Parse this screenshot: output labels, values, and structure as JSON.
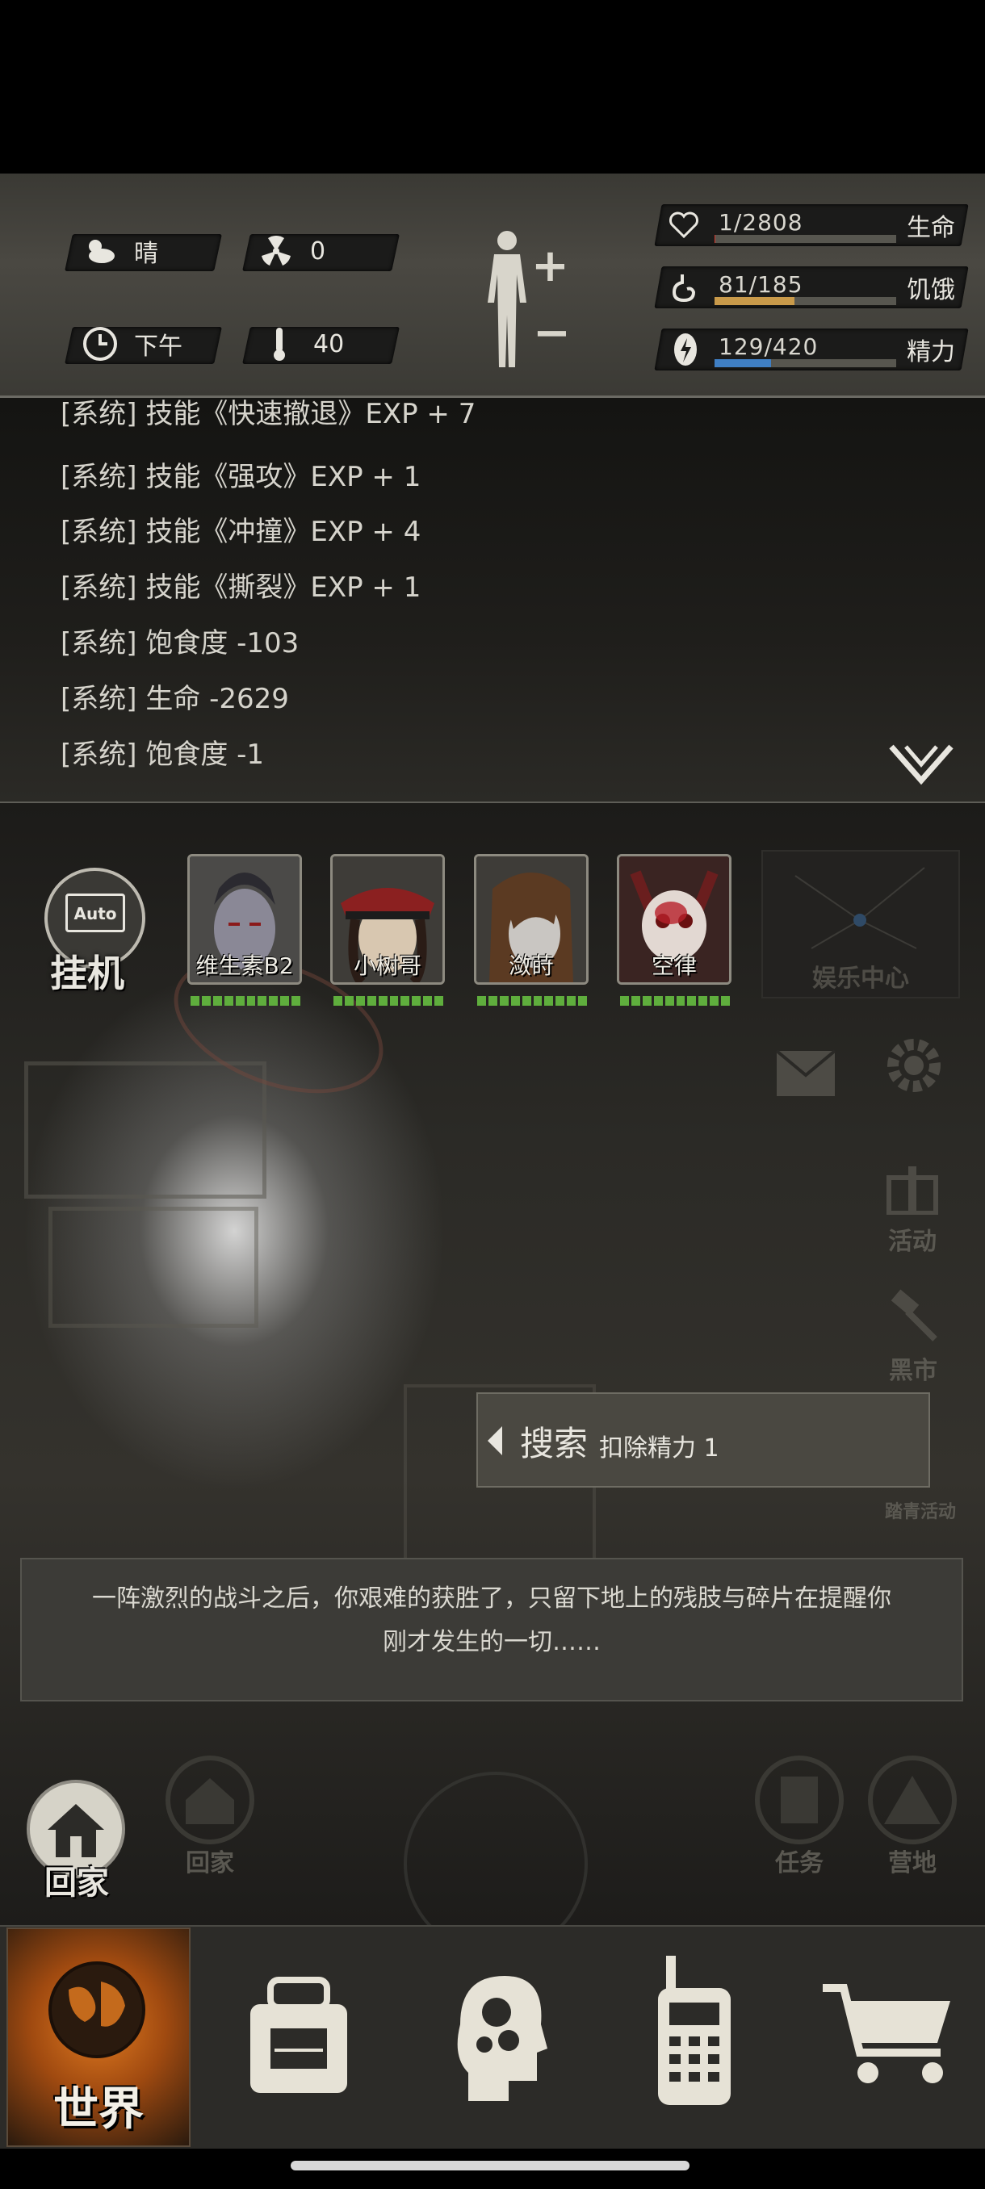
{
  "status": {
    "weather": "晴",
    "radiation": "0",
    "time_of_day": "下午",
    "temperature": "40",
    "stats": [
      {
        "value": "1/2808",
        "label": "生命",
        "fraction": 0.0004,
        "color": "#d8382c",
        "icon": "heart-icon"
      },
      {
        "value": "81/185",
        "label": "饥饿",
        "fraction": 0.44,
        "color": "#c99a4a",
        "icon": "stomach-icon"
      },
      {
        "value": "129/420",
        "label": "精力",
        "fraction": 0.31,
        "color": "#3f7fc4",
        "icon": "energy-icon"
      }
    ]
  },
  "log": [
    "[系统] 技能《快速撤退》EXP + 7",
    "[系统] 技能《强攻》EXP + 1",
    "[系统] 技能《冲撞》EXP + 4",
    "[系统] 技能《撕裂》EXP + 1",
    "[系统] 饱食度 -103",
    "[系统] 生命 -2629",
    "[系统] 饱食度 -1"
  ],
  "auto": {
    "icon_text": "Auto",
    "label": "挂机"
  },
  "companions": [
    {
      "name": "维生素B2"
    },
    {
      "name": "小树哥"
    },
    {
      "name": "潋莳"
    },
    {
      "name": "空律"
    }
  ],
  "entertainment": "娱乐中心",
  "side_buttons": {
    "activity": "活动",
    "black_market": "黑市",
    "outing": "踏青活动",
    "task": "任务",
    "camp": "营地",
    "home_ghost": "回家"
  },
  "search": {
    "title": "搜索",
    "cost": "扣除精力 1"
  },
  "narration": {
    "line1": "一阵激烈的战斗之后，你艰难的获胜了，只留下地上的残肢与碎片在提醒你",
    "line2": "刚才发生的一切……"
  },
  "home": "回家",
  "nav": {
    "world": "世界"
  },
  "colors": {
    "accent": "#c9731f",
    "hp_segment": "#5fae3d"
  }
}
